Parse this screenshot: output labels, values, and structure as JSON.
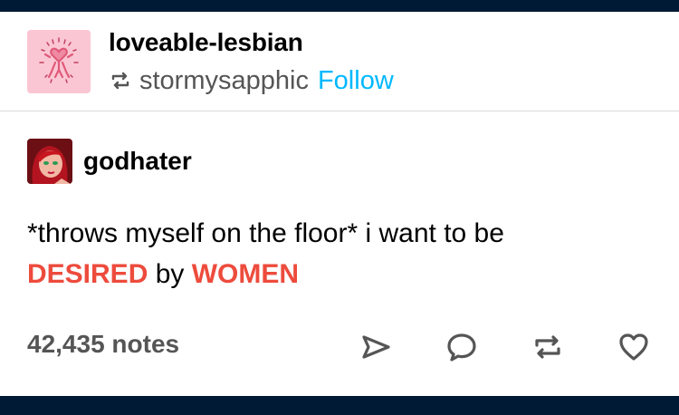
{
  "header": {
    "blog_name": "loveable-lesbian",
    "reblogged_from": "stormysapphic",
    "follow_label": "Follow",
    "avatar_icon": "keith-haring-heart-figure-icon",
    "reblog_icon": "reblog-icon"
  },
  "post": {
    "author": "godhater",
    "avatar_icon": "cartoon-woman-avatar-icon",
    "text_line1": "*throws myself on the floor* i want to be",
    "text_word1": "DESIRED",
    "text_word2": "by",
    "text_word3": "WOMEN"
  },
  "footer": {
    "notes": "42,435 notes",
    "actions": [
      "share-icon",
      "reply-icon",
      "reblog-icon",
      "like-icon"
    ]
  },
  "colors": {
    "background": "#001935",
    "card": "#ffffff",
    "accent_link": "#00b8ff",
    "emphasis": "#ed4b3c",
    "avatar_bg": "#fbc6d3"
  }
}
